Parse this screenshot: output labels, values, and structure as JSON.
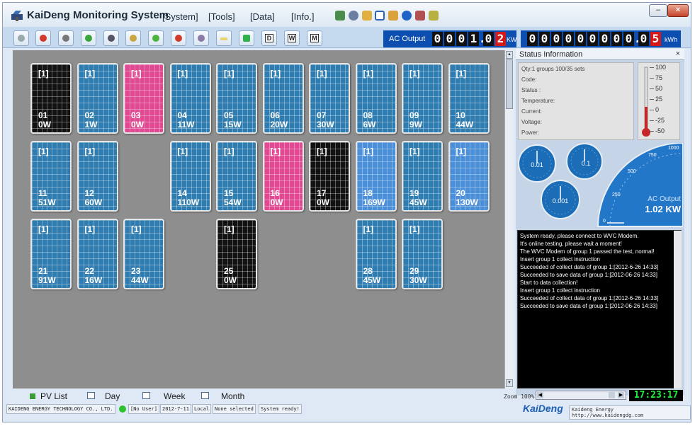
{
  "window": {
    "title": "KaiDeng Monitoring System"
  },
  "menu": [
    "[System]",
    "[Tools]",
    "[Data]",
    "[Info.]"
  ],
  "ac_output": {
    "label": "AC Output",
    "digits": [
      "0",
      "0",
      "0",
      "1",
      ".",
      "0",
      "2"
    ],
    "unit": "KW"
  },
  "energy": {
    "digits": [
      "0",
      "0",
      "0",
      "0",
      "0",
      "0",
      "0",
      "0",
      "0",
      ".",
      "0",
      "5"
    ],
    "unit": "kWh"
  },
  "toolbar": {
    "letters": [
      "D",
      "W",
      "M"
    ]
  },
  "panels": [
    {
      "tag": "[1]",
      "id": "01",
      "power": "0W",
      "state": "black"
    },
    {
      "tag": "[1]",
      "id": "02",
      "power": "1W",
      "state": "blue"
    },
    {
      "tag": "[1]",
      "id": "03",
      "power": "0W",
      "state": "pink"
    },
    {
      "tag": "[1]",
      "id": "04",
      "power": "11W",
      "state": "blue"
    },
    {
      "tag": "[1]",
      "id": "05",
      "power": "15W",
      "state": "blue"
    },
    {
      "tag": "[1]",
      "id": "06",
      "power": "20W",
      "state": "blue"
    },
    {
      "tag": "[1]",
      "id": "07",
      "power": "30W",
      "state": "blue"
    },
    {
      "tag": "[1]",
      "id": "08",
      "power": "6W",
      "state": "blue"
    },
    {
      "tag": "[1]",
      "id": "09",
      "power": "9W",
      "state": "blue"
    },
    {
      "tag": "[1]",
      "id": "10",
      "power": "44W",
      "state": "blue"
    },
    {
      "tag": "[1]",
      "id": "11",
      "power": "51W",
      "state": "blue"
    },
    {
      "tag": "[1]",
      "id": "12",
      "power": "60W",
      "state": "blue"
    },
    {
      "tag": "[1]",
      "id": "14",
      "power": "110W",
      "state": "blue"
    },
    {
      "tag": "[1]",
      "id": "15",
      "power": "54W",
      "state": "blue"
    },
    {
      "tag": "[1]",
      "id": "16",
      "power": "0W",
      "state": "pink"
    },
    {
      "tag": "[1]",
      "id": "17",
      "power": "0W",
      "state": "black"
    },
    {
      "tag": "[1]",
      "id": "18",
      "power": "169W",
      "state": "lblue"
    },
    {
      "tag": "[1]",
      "id": "19",
      "power": "45W",
      "state": "blue"
    },
    {
      "tag": "[1]",
      "id": "20",
      "power": "130W",
      "state": "lblue"
    },
    {
      "tag": "[1]",
      "id": "21",
      "power": "91W",
      "state": "blue"
    },
    {
      "tag": "[1]",
      "id": "22",
      "power": "16W",
      "state": "blue"
    },
    {
      "tag": "[1]",
      "id": "23",
      "power": "44W",
      "state": "blue"
    },
    {
      "tag": "[1]",
      "id": "25",
      "power": "0W",
      "state": "black"
    },
    {
      "tag": "[1]",
      "id": "28",
      "power": "45W",
      "state": "blue"
    },
    {
      "tag": "[1]",
      "id": "29",
      "power": "30W",
      "state": "blue"
    }
  ],
  "status_info": {
    "title": "Status Information",
    "close": "×",
    "rows": [
      "Qty:1 groups 100/35 sets",
      "Code:",
      "Status :",
      "Temperature:",
      "Current:",
      "Voltage:",
      "Power:"
    ],
    "thermo_labels": [
      "100",
      "75",
      "50",
      "25",
      "0",
      "-25",
      "-50"
    ]
  },
  "gauges": {
    "small": [
      "0.01",
      "0.1",
      "0.001"
    ],
    "ac_label": "AC Output",
    "ac_value": "1.02 KW",
    "scale": [
      "0",
      "250",
      "500",
      "750",
      "1000"
    ]
  },
  "log": [
    "System ready, please connect to WVC Modem.",
    "It's online testing, please wait a moment!",
    "The WVC Modem of group 1 passed the test, normal!",
    "Insert group 1 collect instruction",
    "Succeeded of collect data of group 1:[2012-6-26 14:33]",
    "Succeeded to save data of group 1:[2012-06-26 14:33]",
    "Start to data collection!",
    "Insert group 1 collect instruction",
    "Succeeded of collect data of group 1:[2012-6-26 14:33]",
    "Succeeded to save data of group 1:[2012-06-26 14:33]"
  ],
  "tabs": [
    "PV List",
    "Day",
    "Week",
    "Month"
  ],
  "zoom": "Zoom 100%",
  "clock": "17:23:17",
  "status": {
    "company": "KAIDENG ENERGY TECHNOLOGY CO., LTD.",
    "user": "[No User]",
    "date": "2012-7-11",
    "mode": "Local",
    "selection": "None selected",
    "state": "System ready!"
  },
  "brand": {
    "name": "KaiDeng",
    "url": "Kaideng Energy http://www.kaidengdg.com"
  },
  "colors": {
    "accent": "#0d4fb0",
    "panel_blue": "#2f7db0",
    "panel_pink": "#e14a93",
    "panel_black": "#121212",
    "clock_green": "#1ef33b"
  }
}
